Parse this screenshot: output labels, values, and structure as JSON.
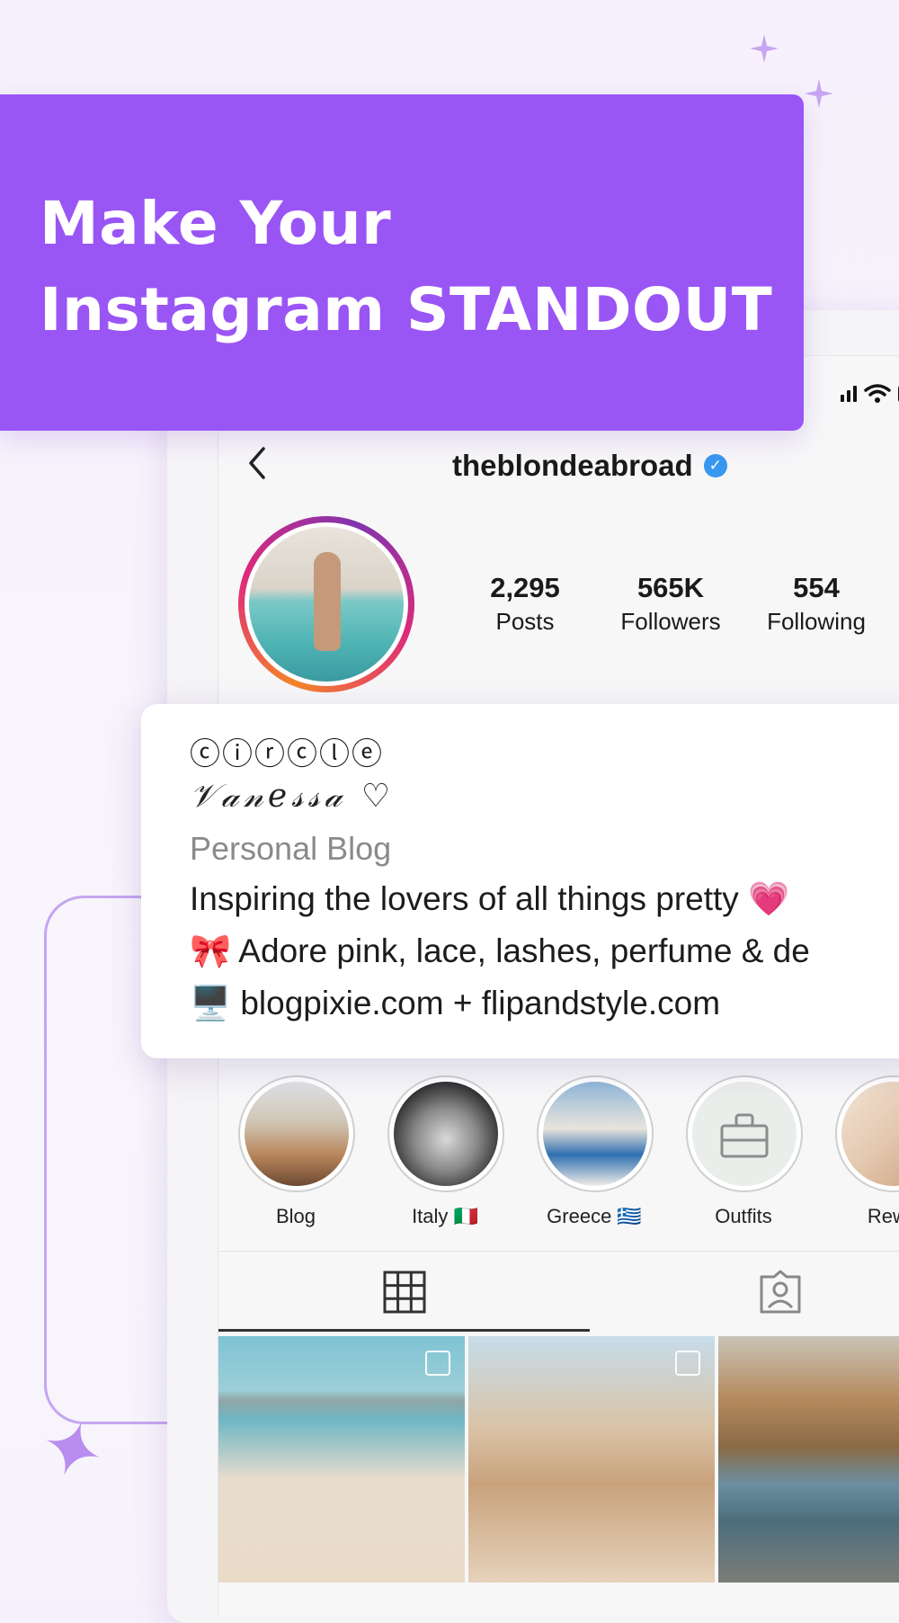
{
  "banner": {
    "headline_line1": "Make Your",
    "headline_line2": "Instagram STANDOUT",
    "color": "#9a55f5"
  },
  "profile": {
    "back_icon": "chevron-left-icon",
    "username": "theblondeabroad",
    "verified_icon": "check",
    "stats": [
      {
        "value": "2,295",
        "label": "Posts"
      },
      {
        "value": "565K",
        "label": "Followers"
      },
      {
        "value": "554",
        "label": "Following"
      }
    ]
  },
  "bio": {
    "circle_name": "ⓒⓘⓡⓒⓛⓔ",
    "display_name": "𝒱𝒶𝓃𝑒𝓈𝓈𝒶 ♡",
    "category": "Personal Blog",
    "line1": "Inspiring the lovers of all things pretty 💗",
    "line2": "🎀 Adore pink, lace, lashes, perfume & de",
    "line3": "🖥️ blogpixie.com + flipandstyle.com"
  },
  "highlights": [
    {
      "label": "Blog"
    },
    {
      "label": "Italy 🇮🇹"
    },
    {
      "label": "Greece 🇬🇷"
    },
    {
      "label": "Outfits"
    },
    {
      "label": "Rewa"
    }
  ],
  "tabs": {
    "grid_icon": "grid-icon",
    "tagged_icon": "tagged-person-icon"
  },
  "colors": {
    "accent": "#9a55f5",
    "decor": "#c5a6f0",
    "verified": "#3897f0"
  }
}
